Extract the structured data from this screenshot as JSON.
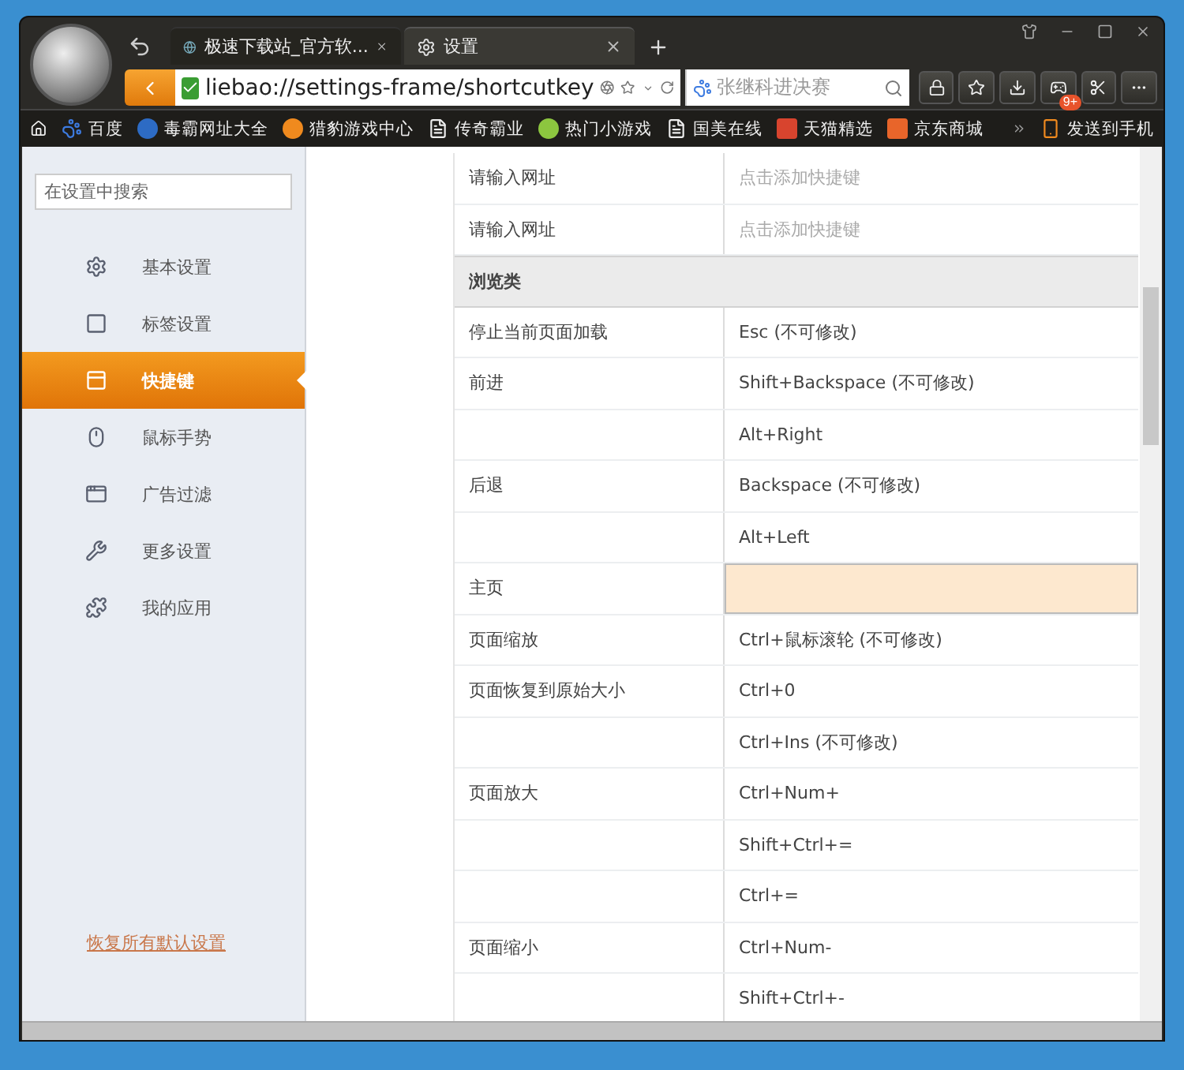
{
  "browser": {
    "tabs": [
      {
        "title": "极速下载站_官方软...",
        "selected": false
      },
      {
        "title": "设置",
        "selected": true
      }
    ],
    "address": "liebao://settings-frame/shortcutkey",
    "search": {
      "value": "张继科进决赛"
    },
    "game_badge": "9+",
    "bookmarks": [
      {
        "label": "百度"
      },
      {
        "label": "毒霸网址大全"
      },
      {
        "label": "猎豹游戏中心"
      },
      {
        "label": "传奇霸业"
      },
      {
        "label": "热门小游戏"
      },
      {
        "label": "国美在线"
      },
      {
        "label": "天猫精选"
      },
      {
        "label": "京东商城"
      }
    ],
    "send_to_phone": "发送到手机"
  },
  "sidebar": {
    "search": {
      "placeholder": "在设置中搜索"
    },
    "items": [
      {
        "label": "基本设置",
        "selected": false
      },
      {
        "label": "标签设置",
        "selected": false
      },
      {
        "label": "快捷键",
        "selected": true
      },
      {
        "label": "鼠标手势",
        "selected": false
      },
      {
        "label": "广告过滤",
        "selected": false
      },
      {
        "label": "更多设置",
        "selected": false
      },
      {
        "label": "我的应用",
        "selected": false
      }
    ],
    "reset_link": "恢复所有默认设置"
  },
  "shortcuts": {
    "rows": [
      {
        "kind": "row",
        "action": "请输入网址",
        "key": "点击添加快捷键",
        "hint": true,
        "editing": false
      },
      {
        "kind": "row",
        "action": "请输入网址",
        "key": "点击添加快捷键",
        "hint": true,
        "editing": false
      },
      {
        "kind": "section",
        "title": "浏览类"
      },
      {
        "kind": "row",
        "action": "停止当前页面加载",
        "key": "Esc (不可修改)",
        "hint": false,
        "editing": false
      },
      {
        "kind": "row",
        "action": "前进",
        "key": "Shift+Backspace (不可修改)",
        "hint": false,
        "editing": false
      },
      {
        "kind": "row",
        "key": "Alt+Right",
        "hint": false,
        "editing": false
      },
      {
        "kind": "row",
        "action": "后退",
        "key": "Backspace (不可修改)",
        "hint": false,
        "editing": false
      },
      {
        "kind": "row",
        "key": "Alt+Left",
        "hint": false,
        "editing": false
      },
      {
        "kind": "row",
        "action": "主页",
        "hint": false,
        "editing": true
      },
      {
        "kind": "row",
        "action": "页面缩放",
        "key": "Ctrl+鼠标滚轮 (不可修改)",
        "hint": false,
        "editing": false
      },
      {
        "kind": "row",
        "action": "页面恢复到原始大小",
        "key": "Ctrl+0",
        "hint": false,
        "editing": false
      },
      {
        "kind": "row",
        "key": "Ctrl+Ins (不可修改)",
        "hint": false,
        "editing": false
      },
      {
        "kind": "row",
        "action": "页面放大",
        "key": "Ctrl+Num+",
        "hint": false,
        "editing": false
      },
      {
        "kind": "row",
        "key": "Shift+Ctrl+=",
        "hint": false,
        "editing": false
      },
      {
        "kind": "row",
        "key": "Ctrl+=",
        "hint": false,
        "editing": false
      },
      {
        "kind": "row",
        "action": "页面缩小",
        "key": "Ctrl+Num-",
        "hint": false,
        "editing": false
      },
      {
        "kind": "row",
        "key": "Shift+Ctrl+-",
        "hint": false,
        "editing": false
      }
    ]
  }
}
